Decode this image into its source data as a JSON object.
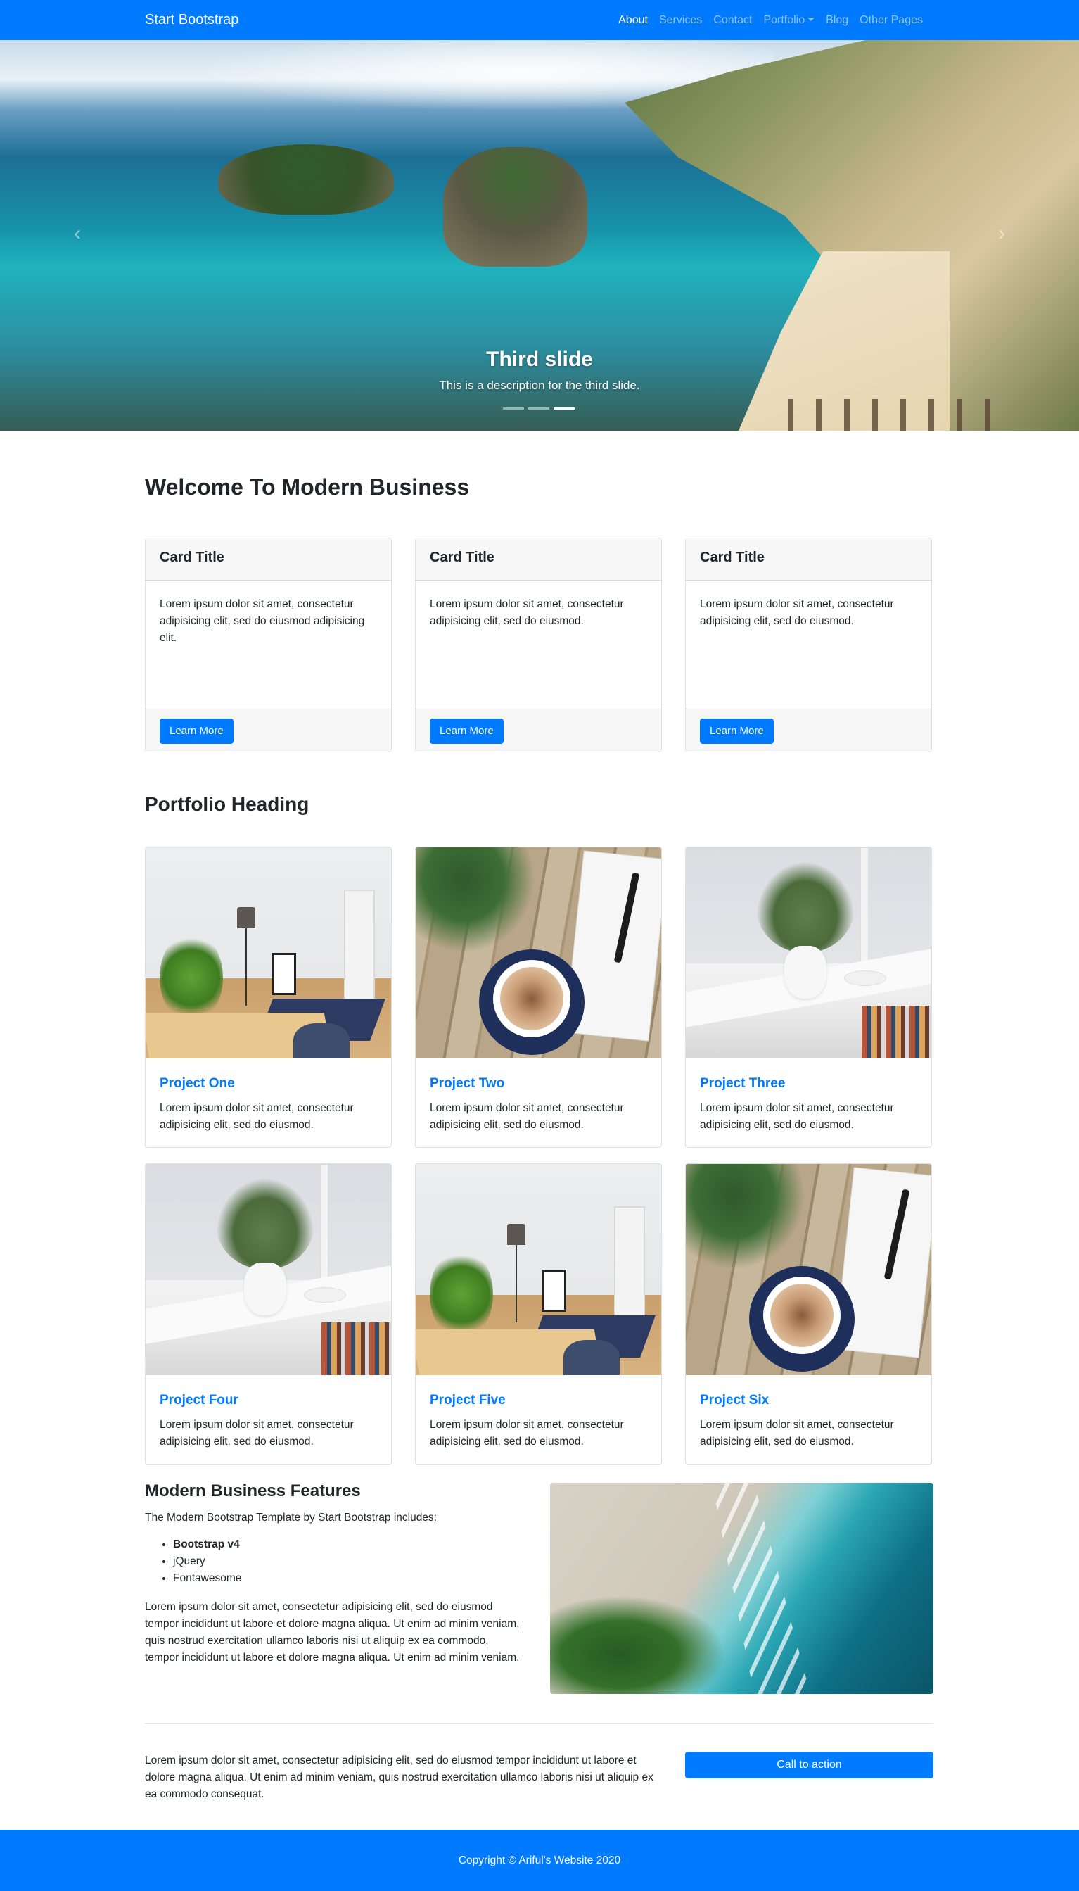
{
  "navbar": {
    "brand": "Start Bootstrap",
    "items": [
      {
        "label": "About",
        "active": true
      },
      {
        "label": "Services"
      },
      {
        "label": "Contact"
      },
      {
        "label": "Portfolio",
        "dropdown": true
      },
      {
        "label": "Blog"
      },
      {
        "label": "Other Pages"
      }
    ]
  },
  "carousel": {
    "slide_title": "Third slide",
    "slide_description": "This is a description for the third slide.",
    "prev_icon": "chevron-left-icon",
    "next_icon": "chevron-right-icon",
    "prev_glyph": "‹",
    "next_glyph": "›",
    "slide_count": 3,
    "active_index": 2
  },
  "welcome": {
    "heading": "Welcome To Modern Business",
    "cards": [
      {
        "title": "Card Title",
        "text": "Lorem ipsum dolor sit amet, consectetur adipisicing elit, sed do eiusmod adipisicing elit.",
        "button": "Learn More"
      },
      {
        "title": "Card Title",
        "text": "Lorem ipsum dolor sit amet, consectetur adipisicing elit, sed do eiusmod.",
        "button": "Learn More"
      },
      {
        "title": "Card Title",
        "text": "Lorem ipsum dolor sit amet, consectetur adipisicing elit, sed do eiusmod.",
        "button": "Learn More"
      }
    ]
  },
  "portfolio": {
    "heading": "Portfolio Heading",
    "projects": [
      {
        "title": "Project One",
        "text": "Lorem ipsum dolor sit amet, consectetur adipisicing elit, sed do eiusmod."
      },
      {
        "title": "Project Two",
        "text": "Lorem ipsum dolor sit amet, consectetur adipisicing elit, sed do eiusmod."
      },
      {
        "title": "Project Three",
        "text": "Lorem ipsum dolor sit amet, consectetur adipisicing elit, sed do eiusmod."
      },
      {
        "title": "Project Four",
        "text": "Lorem ipsum dolor sit amet, consectetur adipisicing elit, sed do eiusmod."
      },
      {
        "title": "Project Five",
        "text": "Lorem ipsum dolor sit amet, consectetur adipisicing elit, sed do eiusmod."
      },
      {
        "title": "Project Six",
        "text": "Lorem ipsum dolor sit amet, consectetur adipisicing elit, sed do eiusmod."
      }
    ]
  },
  "features": {
    "heading": "Modern Business Features",
    "intro": "The Modern Bootstrap Template by Start Bootstrap includes:",
    "list": [
      "Bootstrap v4",
      "jQuery",
      "Fontawesome"
    ],
    "paragraph": "Lorem ipsum dolor sit amet, consectetur adipisicing elit, sed do eiusmod tempor incididunt ut labore et dolore magna aliqua. Ut enim ad minim veniam, quis nostrud exercitation ullamco laboris nisi ut aliquip ex ea commodo, tempor incididunt ut labore et dolore magna aliqua. Ut enim ad minim veniam."
  },
  "cta": {
    "text": "Lorem ipsum dolor sit amet, consectetur adipisicing elit, sed do eiusmod tempor incididunt ut labore et dolore magna aliqua. Ut enim ad minim veniam, quis nostrud exercitation ullamco laboris nisi ut aliquip ex ea commodo consequat.",
    "button": "Call to action"
  },
  "footer": {
    "copyright": "Copyright © Ariful's Website 2020"
  },
  "colors": {
    "primary": "#007bff",
    "text": "#212529",
    "card_header_bg": "#f7f7f7"
  }
}
